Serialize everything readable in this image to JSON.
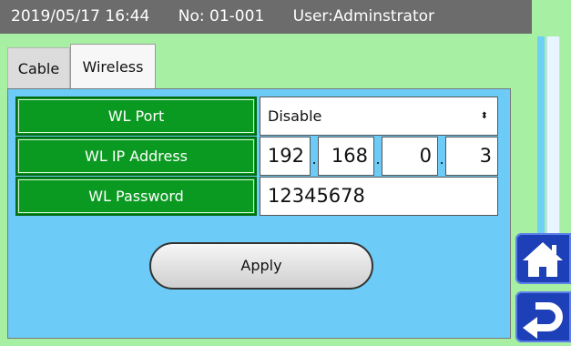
{
  "statusbar": {
    "datetime": "2019/05/17 16:44",
    "number": "No: 01-001",
    "user": "User:Adminstrator"
  },
  "tabs": [
    {
      "label": "Cable"
    },
    {
      "label": "Wireless"
    }
  ],
  "form": {
    "wl_port": {
      "label": "WL Port",
      "value": "Disable",
      "caret": "⬍"
    },
    "wl_ip": {
      "label": "WL IP Address",
      "octets": [
        "192",
        "168",
        "0",
        "3"
      ],
      "dot": "."
    },
    "wl_password": {
      "label": "WL Password",
      "value": "12345678"
    }
  },
  "apply_label": "Apply",
  "colors": {
    "background": "#a7f0a3",
    "panel": "#6cccf7",
    "label_green": "#0b9a21",
    "nav_blue": "#1d3fb8"
  },
  "icons": {
    "home": "home-icon",
    "back": "return-icon"
  }
}
